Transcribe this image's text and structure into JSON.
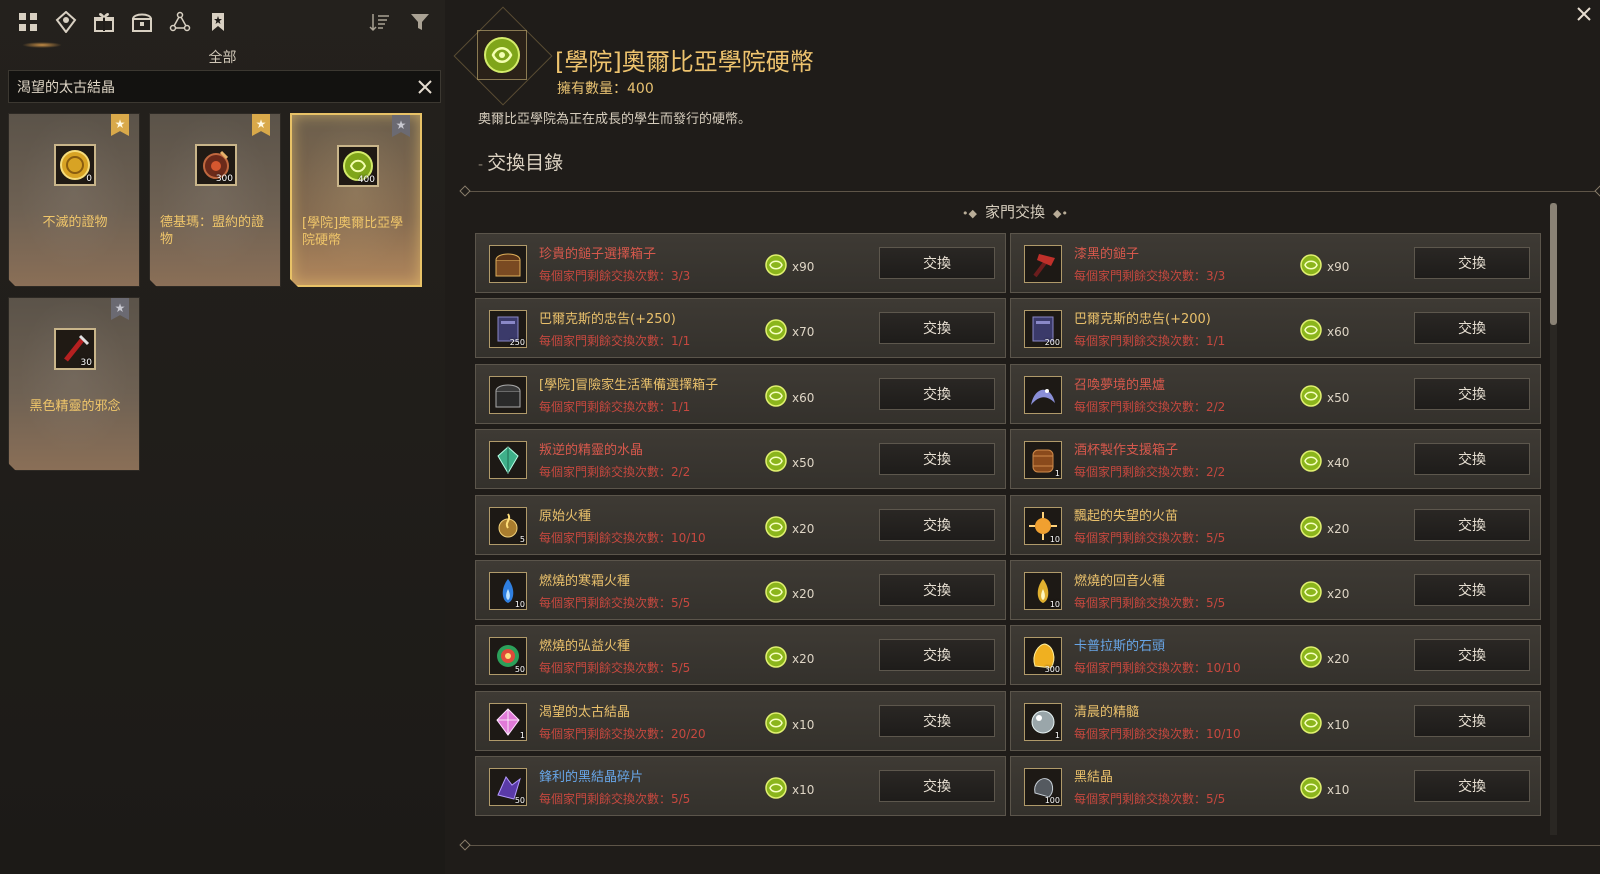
{
  "left": {
    "category": "全部",
    "search": {
      "value": "渴望的太古結晶",
      "placeholder": ""
    },
    "tabs": [
      "grid-icon",
      "map-pin-icon",
      "gift-icon",
      "chest-icon",
      "network-icon",
      "bookmark-icon"
    ],
    "cards": [
      {
        "name": "不滅的證物",
        "count": "0",
        "fav": true,
        "icon": "gold-coin-icon",
        "selected": false
      },
      {
        "name": "德基瑪：盟約的證物",
        "count": "300",
        "fav": true,
        "icon": "red-medal-icon",
        "selected": false
      },
      {
        "name": "[學院]奧爾比亞學院硬幣",
        "count": "400",
        "fav": false,
        "icon": "academy-coin-icon",
        "selected": true
      },
      {
        "name": "黑色精靈的邪念",
        "count": "30",
        "fav": false,
        "icon": "dark-staff-icon",
        "selected": false
      }
    ]
  },
  "header": {
    "title": "[學院]奧爾比亞學院硬幣",
    "owned": "擁有數量：400",
    "description": "奧爾比亞學院為正在成長的學生而發行的硬幣。",
    "section_title": "交換目錄",
    "sub_title": "家門交換"
  },
  "exchange": {
    "button_label": "交換",
    "items": [
      {
        "name": "珍貴的鎚子選擇箱子",
        "limit": "每個家門剩餘交換次數：3/3",
        "cost": "x90",
        "color": "red",
        "icon": "chest-icon",
        "qty": ""
      },
      {
        "name": "漆黑的鎚子",
        "limit": "每個家門剩餘交換次數：3/3",
        "cost": "x90",
        "color": "red",
        "icon": "hammer-icon",
        "qty": ""
      },
      {
        "name": "巴爾克斯的忠告(+250)",
        "limit": "每個家門剩餘交換次數：1/1",
        "cost": "x70",
        "color": "gold",
        "icon": "book-icon",
        "qty": "250"
      },
      {
        "name": "巴爾克斯的忠告(+200)",
        "limit": "每個家門剩餘交換次數：1/1",
        "cost": "x60",
        "color": "gold",
        "icon": "book-icon",
        "qty": "200"
      },
      {
        "name": "[學院]冒險家生活準備選擇箱子",
        "limit": "每個家門剩餘交換次數：1/1",
        "cost": "x60",
        "color": "gold",
        "icon": "dark-chest-icon",
        "qty": ""
      },
      {
        "name": "召喚夢境的黑爐",
        "limit": "每個家門剩餘交換次數：2/2",
        "cost": "x50",
        "color": "red",
        "icon": "dragon-icon",
        "qty": ""
      },
      {
        "name": "叛逆的精靈的水晶",
        "limit": "每個家門剩餘交換次數：2/2",
        "cost": "x50",
        "color": "red",
        "icon": "crystal-icon",
        "qty": ""
      },
      {
        "name": "酒杯製作支援箱子",
        "limit": "每個家門剩餘交換次數：2/2",
        "cost": "x40",
        "color": "red",
        "icon": "barrel-icon",
        "qty": "1"
      },
      {
        "name": "原始火種",
        "limit": "每個家門剩餘交換次數：10/10",
        "cost": "x20",
        "color": "gold",
        "icon": "flame-seed-icon",
        "qty": "5"
      },
      {
        "name": "飄起的失望的火苗",
        "limit": "每個家門剩餘交換次數：5/5",
        "cost": "x20",
        "color": "gold",
        "icon": "sun-flame-icon",
        "qty": "10"
      },
      {
        "name": "燃燒的寒霜火種",
        "limit": "每個家門剩餘交換次數：5/5",
        "cost": "x20",
        "color": "gold",
        "icon": "blue-flame-icon",
        "qty": "10"
      },
      {
        "name": "燃燒的回音火種",
        "limit": "每個家門剩餘交換次數：5/5",
        "cost": "x20",
        "color": "gold",
        "icon": "yellow-flame-icon",
        "qty": "10"
      },
      {
        "name": "燃燒的弘益火種",
        "limit": "每個家門剩餘交換次數：5/5",
        "cost": "x20",
        "color": "gold",
        "icon": "rainbow-flame-icon",
        "qty": "50"
      },
      {
        "name": "卡普拉斯的石頭",
        "limit": "每個家門剩餘交換次數：10/10",
        "cost": "x20",
        "color": "blue",
        "icon": "gold-stone-icon",
        "qty": "300"
      },
      {
        "name": "渴望的太古結晶",
        "limit": "每個家門剩餘交換次數：20/20",
        "cost": "x10",
        "color": "gold",
        "icon": "pink-crystal-icon",
        "qty": "1"
      },
      {
        "name": "清晨的精髓",
        "limit": "每個家門剩餘交換次數：10/10",
        "cost": "x10",
        "color": "gold",
        "icon": "silver-orb-icon",
        "qty": "1"
      },
      {
        "name": "鋒利的黑結晶碎片",
        "limit": "每個家門剩餘交換次數：5/5",
        "cost": "x10",
        "color": "blue",
        "icon": "purple-shard-icon",
        "qty": "50"
      },
      {
        "name": "黑結晶",
        "limit": "每個家門剩餘交換次數：5/5",
        "cost": "x10",
        "color": "gold",
        "icon": "black-crystal-icon",
        "qty": "100"
      }
    ]
  },
  "colors": {
    "gold": "#e9c06b",
    "red_limit": "#c6483f",
    "blue": "#68a6e8",
    "accent": "#e8c267"
  }
}
